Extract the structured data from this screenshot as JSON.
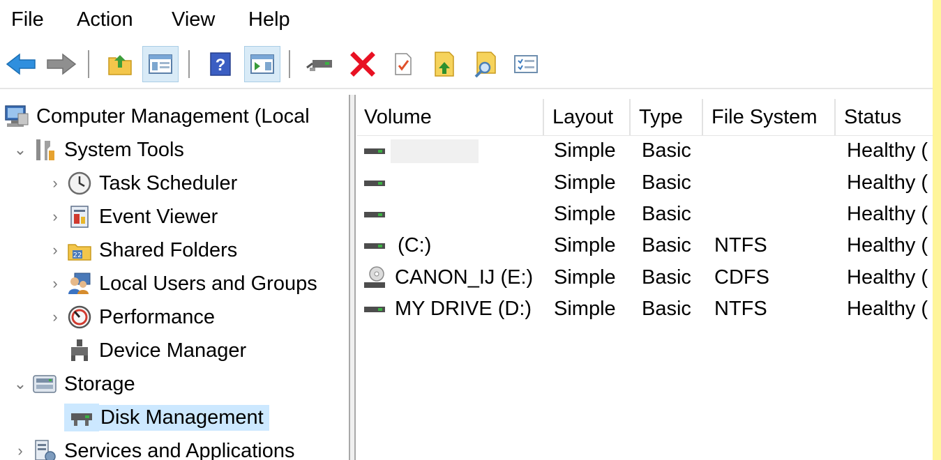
{
  "menu": {
    "items": [
      {
        "name": "menu-file",
        "label": "File"
      },
      {
        "name": "menu-action",
        "label": "Action"
      },
      {
        "name": "menu-view",
        "label": "View"
      },
      {
        "name": "menu-help",
        "label": "Help"
      }
    ]
  },
  "toolbar": {
    "buttons": [
      {
        "name": "back-button",
        "icon": "arrow-left-icon"
      },
      {
        "name": "forward-button",
        "icon": "arrow-right-icon"
      },
      {
        "name": "up-one-level-button",
        "icon": "folder-up-icon"
      },
      {
        "name": "show-hide-console-tree-button",
        "icon": "console-tree-icon",
        "active": true
      },
      {
        "name": "help-button",
        "icon": "help-icon"
      },
      {
        "name": "show-hide-action-pane-button",
        "icon": "action-pane-icon",
        "active": true
      },
      {
        "name": "connect-drive-button",
        "icon": "drive-connect-icon"
      },
      {
        "name": "delete-button",
        "icon": "delete-x-icon"
      },
      {
        "name": "properties-button",
        "icon": "checklist-doc-icon"
      },
      {
        "name": "export-list-button",
        "icon": "folder-export-icon"
      },
      {
        "name": "search-folder-button",
        "icon": "folder-search-icon"
      },
      {
        "name": "list-view-button",
        "icon": "list-icon"
      }
    ]
  },
  "tree": {
    "items": [
      {
        "name": "tree-root-computer-management",
        "label": "Computer Management (Local",
        "icon": "computer-management-icon",
        "chevron": ""
      },
      {
        "name": "tree-item-system-tools",
        "label": "System Tools",
        "icon": "tools-icon",
        "chevron": "expanded"
      },
      {
        "name": "tree-item-task-scheduler",
        "label": "Task Scheduler",
        "icon": "clock-icon",
        "chevron": "collapsed"
      },
      {
        "name": "tree-item-event-viewer",
        "label": "Event Viewer",
        "icon": "event-viewer-icon",
        "chevron": "collapsed"
      },
      {
        "name": "tree-item-shared-folders",
        "label": "Shared Folders",
        "icon": "shared-folder-icon",
        "chevron": "collapsed"
      },
      {
        "name": "tree-item-local-users-groups",
        "label": "Local Users and Groups",
        "icon": "users-icon",
        "chevron": "collapsed"
      },
      {
        "name": "tree-item-performance",
        "label": "Performance",
        "icon": "performance-icon",
        "chevron": "collapsed"
      },
      {
        "name": "tree-item-device-manager",
        "label": "Device Manager",
        "icon": "device-manager-icon",
        "chevron": ""
      },
      {
        "name": "tree-item-storage",
        "label": "Storage",
        "icon": "storage-icon",
        "chevron": "expanded"
      },
      {
        "name": "tree-item-disk-management",
        "label": "Disk Management",
        "icon": "disk-management-icon",
        "chevron": "",
        "selected": true
      },
      {
        "name": "tree-item-services-applications",
        "label": "Services and Applications",
        "icon": "services-icon",
        "chevron": "collapsed"
      }
    ]
  },
  "volumes": {
    "columns": [
      {
        "name": "column-volume",
        "label": "Volume"
      },
      {
        "name": "column-layout",
        "label": "Layout"
      },
      {
        "name": "column-type",
        "label": "Type"
      },
      {
        "name": "column-file-system",
        "label": "File System"
      },
      {
        "name": "column-status",
        "label": "Status"
      }
    ],
    "rows": [
      {
        "volume": "",
        "layout": "Simple",
        "type": "Basic",
        "file_system": "",
        "status": "Healthy (",
        "icon": "drive-icon",
        "redacted": true
      },
      {
        "volume": "",
        "layout": "Simple",
        "type": "Basic",
        "file_system": "",
        "status": "Healthy (",
        "icon": "drive-icon"
      },
      {
        "volume": "",
        "layout": "Simple",
        "type": "Basic",
        "file_system": "",
        "status": "Healthy (",
        "icon": "drive-icon"
      },
      {
        "volume": " (C:)",
        "layout": "Simple",
        "type": "Basic",
        "file_system": "NTFS",
        "status": "Healthy (",
        "icon": "drive-icon"
      },
      {
        "volume": "CANON_IJ (E:)",
        "layout": "Simple",
        "type": "Basic",
        "file_system": "CDFS",
        "status": "Healthy (",
        "icon": "cd-drive-icon"
      },
      {
        "volume": "MY DRIVE (D:)",
        "layout": "Simple",
        "type": "Basic",
        "file_system": "NTFS",
        "status": "Healthy (",
        "icon": "drive-icon"
      }
    ]
  },
  "colors": {
    "selection": "#cce8ff",
    "toolbar_active": "#d9ebf7",
    "edge_strip": "#fff59a",
    "delete_red": "#e81123",
    "drive_green": "#3cb043"
  }
}
